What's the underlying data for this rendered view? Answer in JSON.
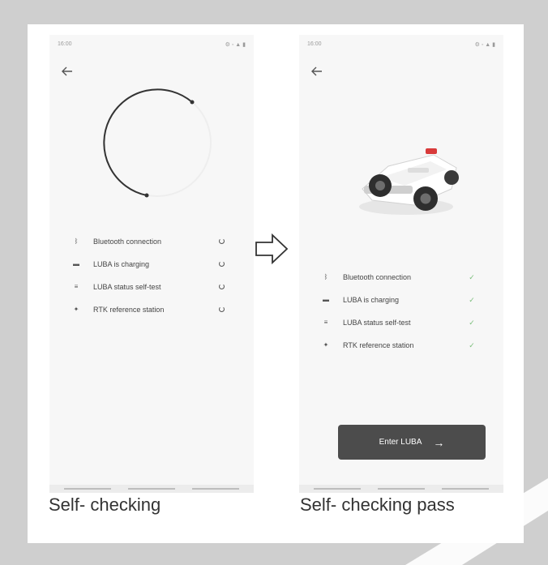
{
  "left_screen": {
    "status_time": "16:00",
    "status_icons": "⚙ ◦ ▲ ▮",
    "checks": [
      {
        "label": "Bluetooth connection",
        "icon": "bluetooth-icon",
        "state": "checking"
      },
      {
        "label": "LUBA is charging",
        "icon": "battery-icon",
        "state": "checking"
      },
      {
        "label": "LUBA status self-test",
        "icon": "status-icon",
        "state": "checking"
      },
      {
        "label": "RTK reference station",
        "icon": "rtk-icon",
        "state": "checking"
      }
    ]
  },
  "right_screen": {
    "status_time": "16:00",
    "status_icons": "⚙ ◦ ▲ ▮",
    "checks": [
      {
        "label": "Bluetooth connection",
        "icon": "bluetooth-icon",
        "state": "passed"
      },
      {
        "label": "LUBA is charging",
        "icon": "battery-icon",
        "state": "passed"
      },
      {
        "label": "LUBA status self-test",
        "icon": "status-icon",
        "state": "passed"
      },
      {
        "label": "RTK reference station",
        "icon": "rtk-icon",
        "state": "passed"
      }
    ],
    "enter_button_label": "Enter LUBA"
  },
  "captions": {
    "left": "Self- checking",
    "right": "Self- checking pass"
  },
  "colors": {
    "background": "#cfcfcf",
    "button": "#4c4c4c",
    "check_tick": "#7bbf7b"
  }
}
